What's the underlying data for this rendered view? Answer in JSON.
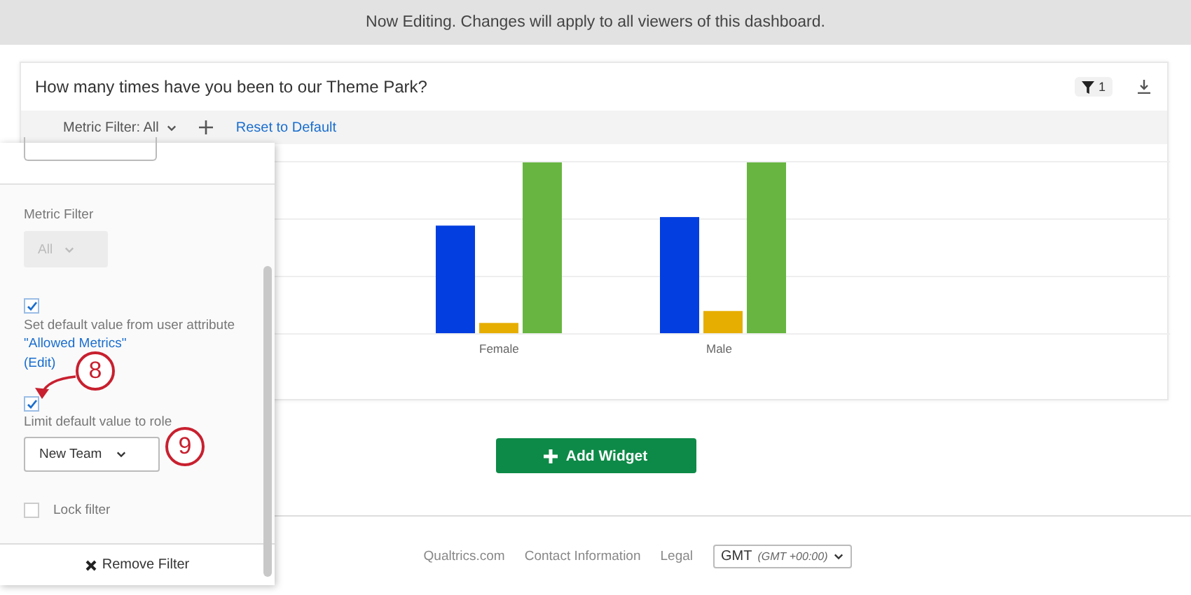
{
  "banner": {
    "text": "Now Editing. Changes will apply to all viewers of this dashboard."
  },
  "widget": {
    "title": "How many times have you been to our Theme Park?",
    "filter_count": "1",
    "toolbar": {
      "metric_filter": "Metric Filter: All",
      "reset_link": "Reset to Default"
    },
    "chart": {
      "categories": [
        "Female",
        "Male"
      ]
    }
  },
  "filter_panel": {
    "metric_label": "Metric Filter",
    "metric_value": "All",
    "metric_disabled": true,
    "options": [
      {
        "kind": "attribute",
        "checked": true,
        "text": "Set default value from user attribute",
        "link": "\"Allowed Metrics\"",
        "edit": "(Edit)"
      },
      {
        "kind": "role",
        "checked": true,
        "text": "Limit default value to role",
        "value": "New Team"
      },
      {
        "kind": "plain",
        "checked": false,
        "text": "Lock filter"
      }
    ],
    "remove_button": "Remove Filter"
  },
  "callouts": [
    "8",
    "9"
  ],
  "add_widget": "Add Widget",
  "footer": {
    "links": [
      "Qualtrics.com",
      "Contact Information",
      "Legal"
    ],
    "timezone": "GMT",
    "timezone_offset": "(GMT +00:00)"
  }
}
